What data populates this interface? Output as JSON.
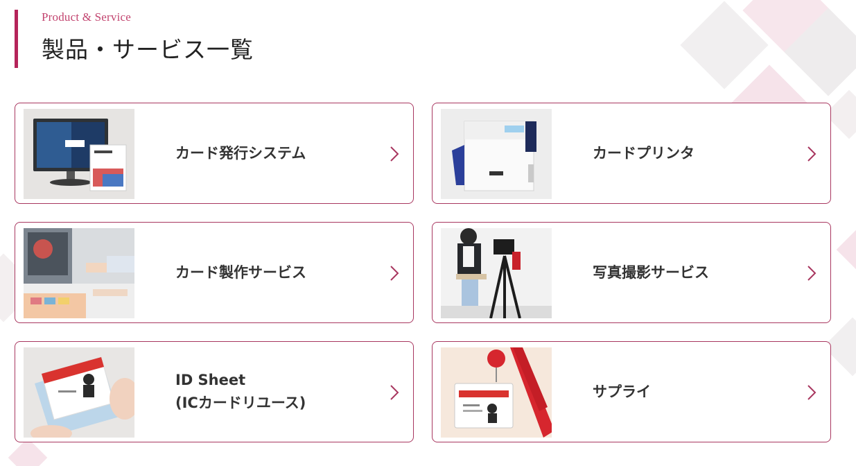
{
  "header": {
    "eyebrow": "Product & Service",
    "title": "製品・サービス一覧"
  },
  "cards": [
    {
      "label": "カード発行システム",
      "thumb_icon": "card-issuing-software-photo"
    },
    {
      "label": "カードプリンタ",
      "thumb_icon": "card-printer-photo"
    },
    {
      "label": "カード製作サービス",
      "thumb_icon": "card-production-photo"
    },
    {
      "label": "写真撮影サービス",
      "thumb_icon": "photo-shooting-photo"
    },
    {
      "label_line1": "ID Sheet",
      "label_line2": "(ICカードリユース)",
      "thumb_icon": "id-sheet-photo"
    },
    {
      "label": "サプライ",
      "thumb_icon": "supply-lanyard-photo"
    }
  ],
  "colors": {
    "accent": "#b5245a",
    "eyebrow": "#c2446f",
    "card_border": "#a8365f",
    "text": "#333333"
  }
}
